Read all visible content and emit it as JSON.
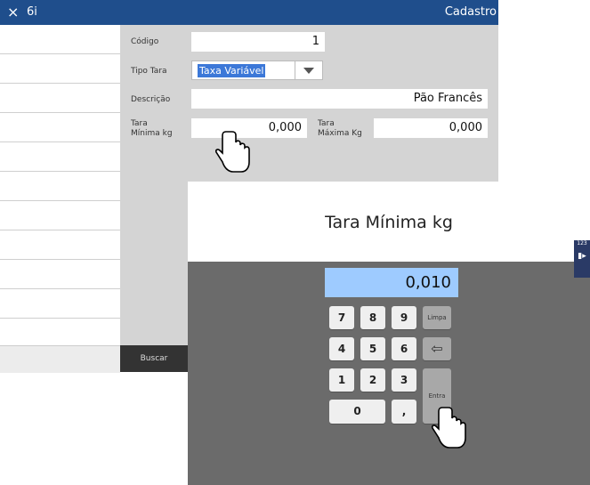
{
  "titlebar": {
    "close_icon": "×",
    "app_name": "6i",
    "page_title": "Cadastro"
  },
  "form": {
    "codigo": {
      "label": "Código",
      "value": "1"
    },
    "tipo_tara": {
      "label": "Tipo Tara",
      "value": "Taxa Variável"
    },
    "descricao": {
      "label": "Descrição",
      "value": "Pão Francês"
    },
    "tara_minima": {
      "label_line1": "Tara",
      "label_line2": "Mínima kg",
      "value": "0,000"
    },
    "tara_maxima": {
      "label_line1": "Tara",
      "label_line2": "Máxima Kg",
      "value": "0,000"
    }
  },
  "sidebar": {
    "buscar_label": "Buscar"
  },
  "keypad": {
    "title": "Tara Mínima kg",
    "display_value": "0,010",
    "keys": {
      "k7": "7",
      "k8": "8",
      "k9": "9",
      "k4": "4",
      "k5": "5",
      "k6": "6",
      "k1": "1",
      "k2": "2",
      "k3": "3",
      "k0": "0",
      "comma": ",",
      "limpa": "Limpa",
      "entra": "Entra",
      "backspace_icon": "⇦"
    }
  },
  "side_tab": {
    "label": "123"
  }
}
